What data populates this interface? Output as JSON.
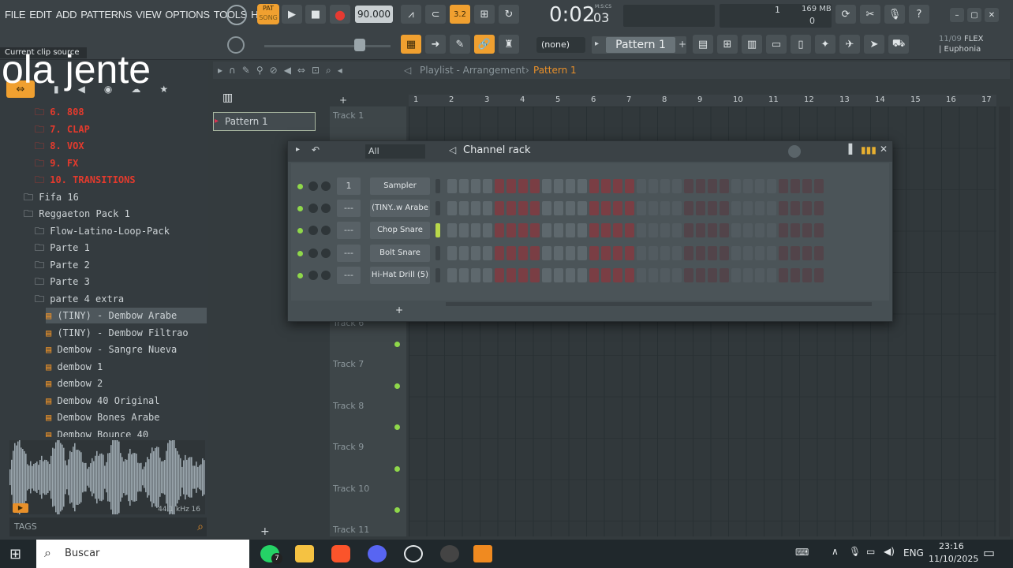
{
  "overlay": {
    "caption": "ola jente",
    "hint": "Current clip source"
  },
  "menu": [
    "FILE",
    "EDIT",
    "ADD",
    "PATTERNS",
    "VIEW",
    "OPTIONS",
    "TOOLS",
    "HELP"
  ],
  "transport": {
    "mode": "PAT",
    "mode_sub": "SONG",
    "tempo": "90.000",
    "time": "0:02",
    "time_frac": "03",
    "time_unit": "M:S:CS"
  },
  "cpu": {
    "value": "1",
    "mem": "169 MB",
    "voices": "0"
  },
  "toolbar2": {
    "snap": "(none)",
    "pattern": "Pattern 1"
  },
  "news": {
    "date": "11/09",
    "label": "FLEX",
    "pack": "| Euphonia"
  },
  "browser": {
    "items": [
      {
        "label": "6. 808",
        "type": "red",
        "indent": 1
      },
      {
        "label": "7. CLAP",
        "type": "red",
        "indent": 1
      },
      {
        "label": "8. VOX",
        "type": "red",
        "indent": 1
      },
      {
        "label": "9. FX",
        "type": "red",
        "indent": 1
      },
      {
        "label": "10. TRANSITIONS",
        "type": "red",
        "indent": 1
      },
      {
        "label": "Fifa 16",
        "type": "folder",
        "indent": 0
      },
      {
        "label": "Reggaeton Pack 1",
        "type": "folder",
        "indent": 0
      },
      {
        "label": "Flow-Latino-Loop-Pack",
        "type": "folder",
        "indent": 1
      },
      {
        "label": "Parte 1",
        "type": "folder",
        "indent": 1
      },
      {
        "label": "Parte 2",
        "type": "folder",
        "indent": 1
      },
      {
        "label": "Parte 3",
        "type": "folder",
        "indent": 1
      },
      {
        "label": "parte 4 extra",
        "type": "folder",
        "indent": 1
      },
      {
        "label": "(TINY) - Dembow Arabe",
        "type": "file-sel",
        "indent": 2
      },
      {
        "label": "(TINY) - Dembow Filtrao",
        "type": "file",
        "indent": 2
      },
      {
        "label": "Dembow - Sangre Nueva",
        "type": "file",
        "indent": 2
      },
      {
        "label": "dembow 1",
        "type": "file",
        "indent": 2
      },
      {
        "label": "dembow 2",
        "type": "file",
        "indent": 2
      },
      {
        "label": "Dembow 40 Original",
        "type": "file",
        "indent": 2
      },
      {
        "label": "Dembow Bones Arabe",
        "type": "file",
        "indent": 2
      },
      {
        "label": "Dembow Bounce 40",
        "type": "file",
        "indent": 2
      }
    ],
    "wave_info": "44.1 kHz 16",
    "tags": "TAGS"
  },
  "playlist": {
    "title": "Playlist - Arrangement",
    "crumb": "Pattern 1",
    "pattern_item": "Pattern 1",
    "ruler": [
      "1",
      "2",
      "3",
      "4",
      "5",
      "6",
      "7",
      "8",
      "9",
      "10",
      "11",
      "12",
      "13",
      "14",
      "15",
      "16",
      "17"
    ],
    "tracks": [
      "Track 1",
      "Track 6",
      "Track 7",
      "Track 8",
      "Track 9",
      "Track 10",
      "Track 11"
    ]
  },
  "channel_rack": {
    "title": "Channel rack",
    "filter": "All",
    "channels": [
      {
        "num": "1",
        "name": "Sampler"
      },
      {
        "num": "---",
        "name": "(TINY..w Arabe"
      },
      {
        "num": "---",
        "name": "Chop Snare"
      },
      {
        "num": "---",
        "name": "Bolt Snare"
      },
      {
        "num": "---",
        "name": "Hi-Hat Drill (5)"
      }
    ],
    "steps": 32
  },
  "taskbar": {
    "search": "Buscar",
    "lang": "ENG",
    "clock": "23:16",
    "date": "11/10/2025",
    "badge": "7"
  }
}
